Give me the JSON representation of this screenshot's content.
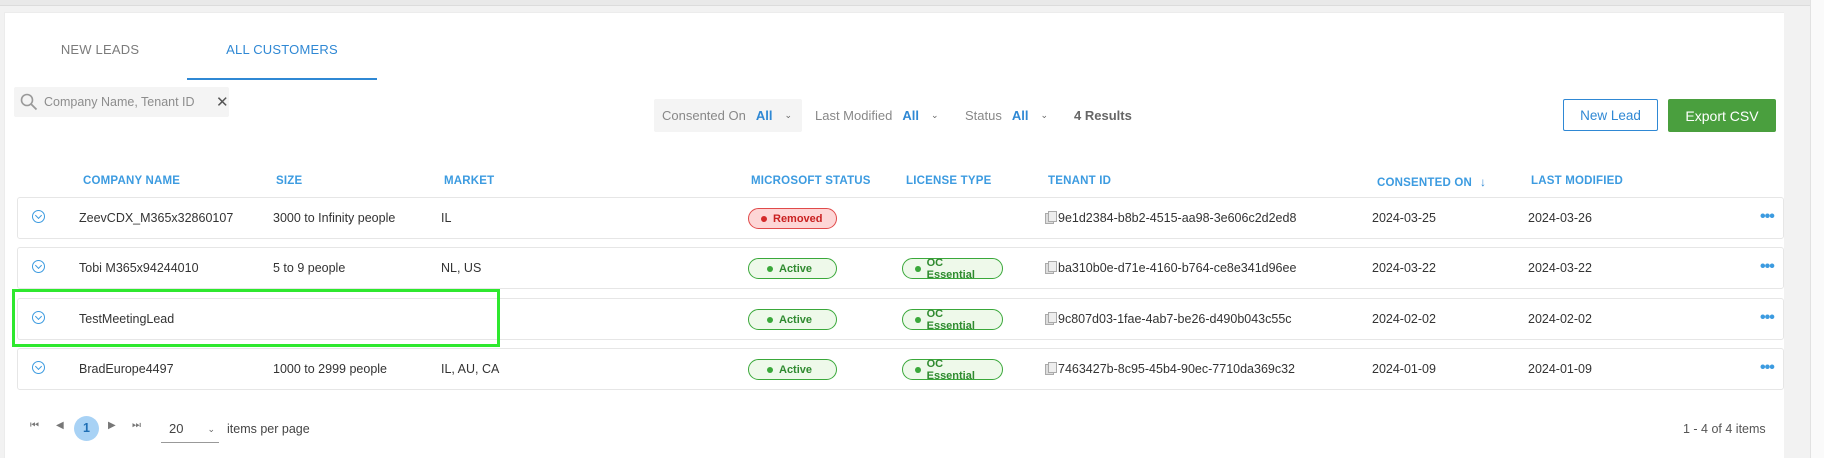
{
  "tabs": [
    {
      "label": "NEW LEADS",
      "active": false
    },
    {
      "label": "ALL CUSTOMERS",
      "active": true
    }
  ],
  "search": {
    "placeholder": "Company Name, Tenant ID",
    "value": ""
  },
  "filters": {
    "consented": {
      "label": "Consented On",
      "value": "All"
    },
    "modified": {
      "label": "Last Modified",
      "value": "All"
    },
    "status": {
      "label": "Status",
      "value": "All"
    }
  },
  "results": "4 Results",
  "buttons": {
    "new_lead": "New Lead",
    "export": "Export CSV"
  },
  "columns": {
    "company": "COMPANY NAME",
    "size": "SIZE",
    "market": "MARKET",
    "ms_status": "MICROSOFT STATUS",
    "license": "LICENSE TYPE",
    "tenant": "TENANT ID",
    "consented": "CONSENTED ON",
    "modified": "LAST MODIFIED"
  },
  "sort": {
    "column": "consented",
    "direction": "desc"
  },
  "rows": [
    {
      "company": "ZeevCDX_M365x32860107",
      "size": "3000 to Infinity people",
      "market": "IL",
      "ms_status": "Removed",
      "license": "",
      "tenant": "9e1d2384-b8b2-4515-aa98-3e606c2d2ed8",
      "consented": "2024-03-25",
      "modified": "2024-03-26"
    },
    {
      "company": "Tobi M365x94244010",
      "size": "5 to 9 people",
      "market": "NL, US",
      "ms_status": "Active",
      "license": "OC Essential",
      "tenant": "ba310b0e-d71e-4160-b764-ce8e341d96ee",
      "consented": "2024-03-22",
      "modified": "2024-03-22"
    },
    {
      "company": "TestMeetingLead",
      "size": "",
      "market": "",
      "ms_status": "Active",
      "license": "OC Essential",
      "tenant": "9c807d03-1fae-4ab7-be26-d490b043c55c",
      "consented": "2024-02-02",
      "modified": "2024-02-02"
    },
    {
      "company": "BradEurope4497",
      "size": "1000 to 2999 people",
      "market": "IL, AU, CA",
      "ms_status": "Active",
      "license": "OC Essential",
      "tenant": "7463427b-8c95-45b4-90ec-7710da369c32",
      "consented": "2024-01-09",
      "modified": "2024-01-09"
    }
  ],
  "pagination": {
    "current_page": "1",
    "per_page": "20",
    "per_page_label": "items per page",
    "count": "1 - 4 of 4 items"
  },
  "colors": {
    "accent": "#2f88d4",
    "export": "#4a9f3e",
    "active": "#3aa83a",
    "removed": "#d42a2a",
    "highlight": "#2ee82e"
  }
}
